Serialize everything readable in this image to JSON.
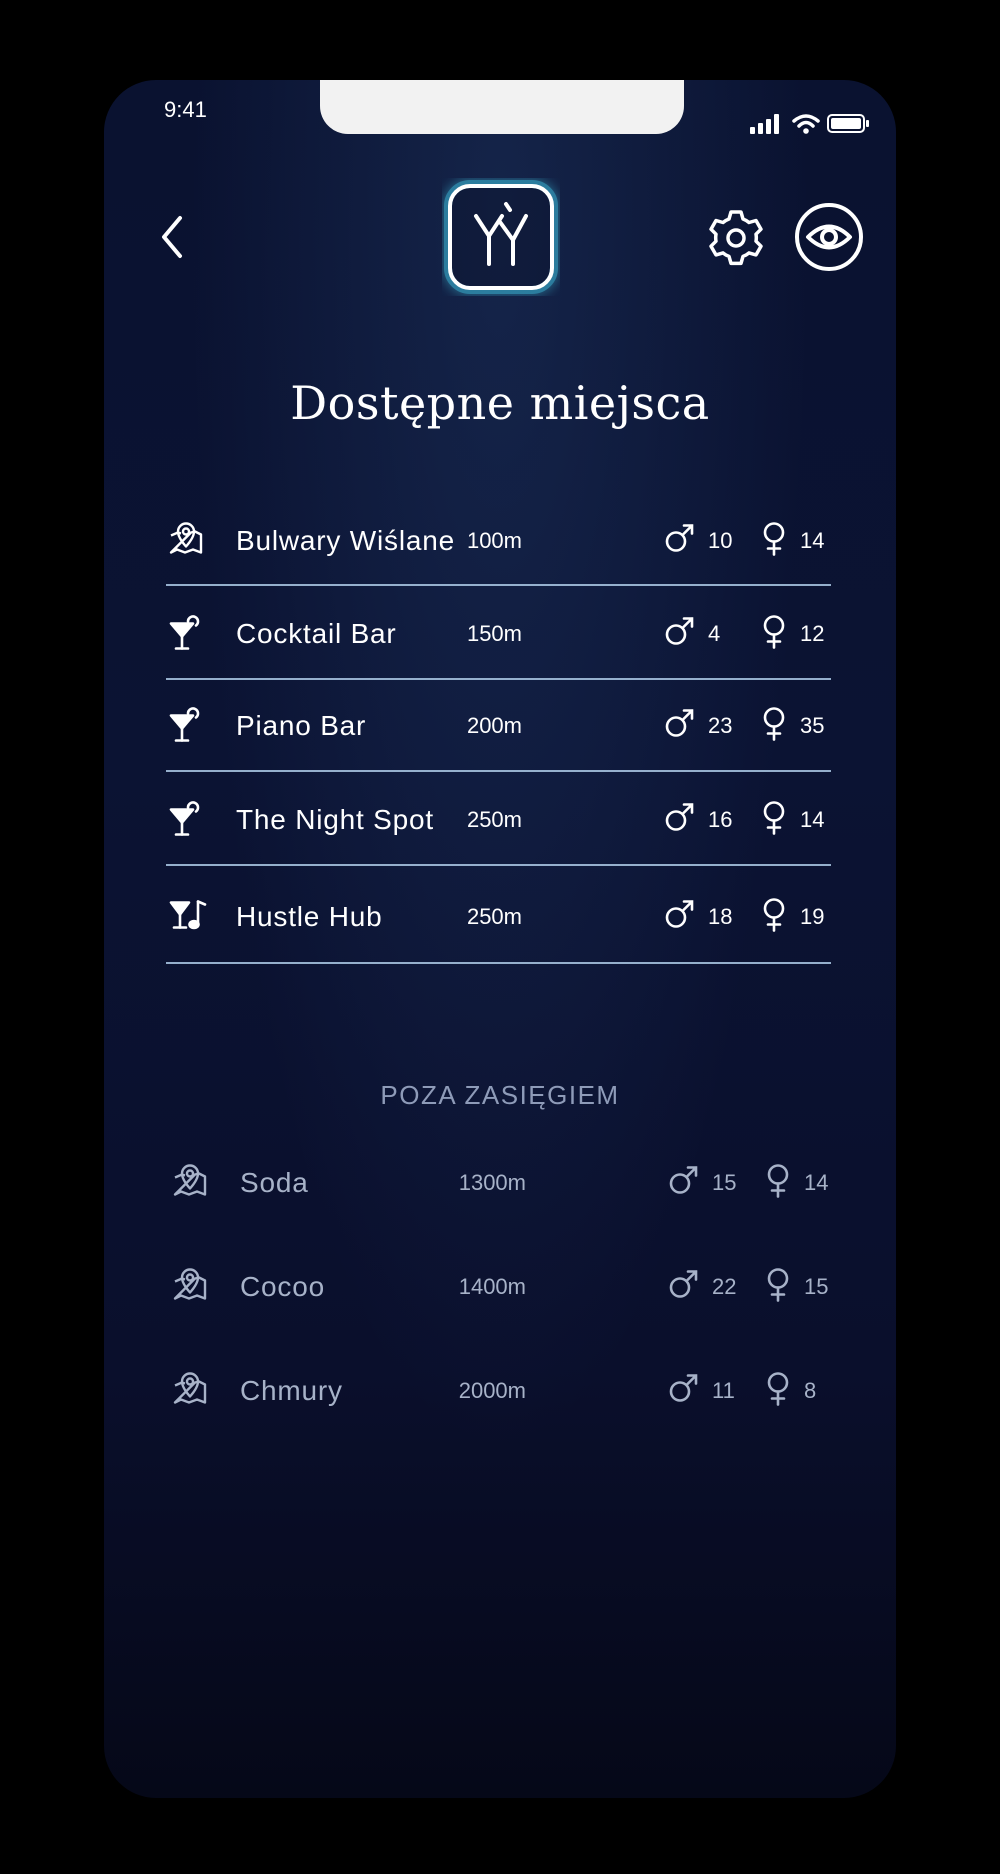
{
  "status": {
    "time": "9:41"
  },
  "header": {
    "title": "Dostępne miejsca"
  },
  "available": [
    {
      "name": "Bulwary Wiślane",
      "distance": "100m",
      "male": "10",
      "female": "14",
      "icon": "map-pin-icon"
    },
    {
      "name": "Cocktail Bar",
      "distance": "150m",
      "male": "4",
      "female": "12",
      "icon": "cocktail-icon"
    },
    {
      "name": "Piano Bar",
      "distance": "200m",
      "male": "23",
      "female": "35",
      "icon": "cocktail-icon"
    },
    {
      "name": "The Night Spot",
      "distance": "250m",
      "male": "16",
      "female": "14",
      "icon": "cocktail-icon"
    },
    {
      "name": "Hustle Hub",
      "distance": "250m",
      "male": "18",
      "female": "19",
      "icon": "cocktail-music-icon"
    }
  ],
  "out_of_range": {
    "label": "POZA ZASIĘGIEM",
    "items": [
      {
        "name": "Soda",
        "distance": "1300m",
        "male": "15",
        "female": "14",
        "icon": "map-pin-icon"
      },
      {
        "name": "Cocoo",
        "distance": "1400m",
        "male": "22",
        "female": "15",
        "icon": "map-pin-icon"
      },
      {
        "name": "Chmury",
        "distance": "2000m",
        "male": "11",
        "female": "8",
        "icon": "map-pin-icon"
      }
    ]
  },
  "colors": {
    "background": "#0b1333",
    "accent_glow": "#3fc8e6",
    "divider": "#aecbe8",
    "muted_text": "#a7b2c8"
  }
}
